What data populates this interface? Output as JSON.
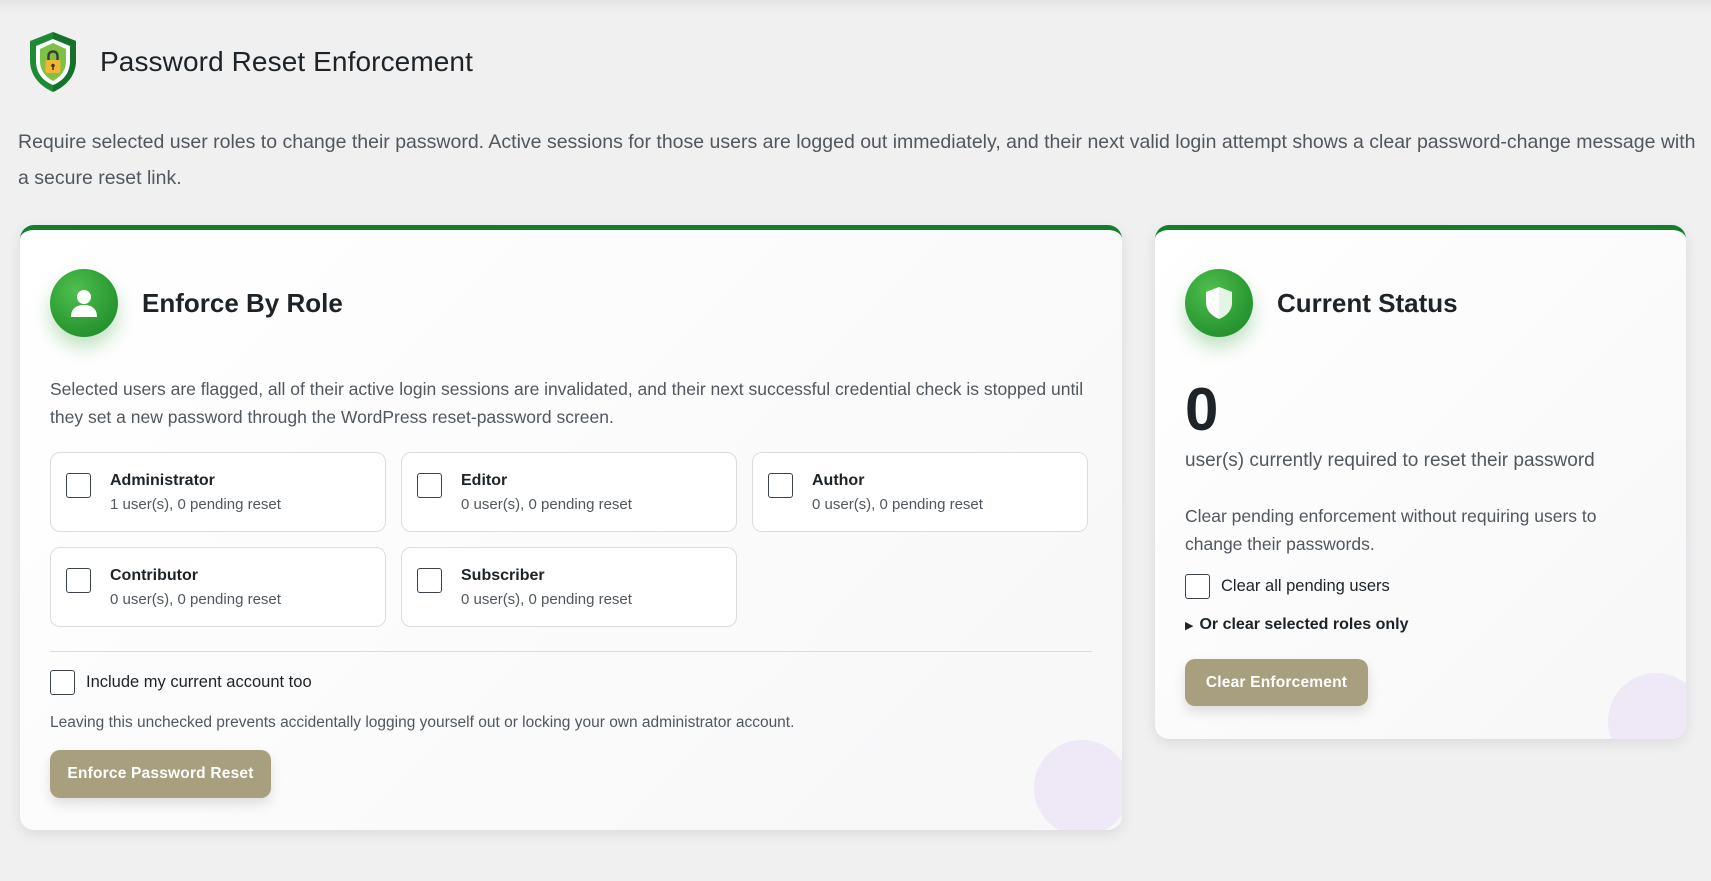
{
  "page": {
    "title": "Password Reset Enforcement",
    "intro": "Require selected user roles to change their password. Active sessions for those users are logged out immediately, and their next valid login attempt shows a clear password-change message with a secure reset link."
  },
  "enforce": {
    "title": "Enforce By Role",
    "description": "Selected users are flagged, all of their active login sessions are invalidated, and their next successful credential check is stopped until they set a new password through the WordPress reset-password screen.",
    "roles": [
      {
        "name": "Administrator",
        "meta": "1 user(s), 0 pending reset"
      },
      {
        "name": "Editor",
        "meta": "0 user(s), 0 pending reset"
      },
      {
        "name": "Author",
        "meta": "0 user(s), 0 pending reset"
      },
      {
        "name": "Contributor",
        "meta": "0 user(s), 0 pending reset"
      },
      {
        "name": "Subscriber",
        "meta": "0 user(s), 0 pending reset"
      }
    ],
    "include_label": "Include my current account too",
    "include_help": "Leaving this unchecked prevents accidentally logging yourself out or locking your own administrator account.",
    "button": "Enforce Password Reset"
  },
  "status": {
    "title": "Current Status",
    "count": "0",
    "count_label": "user(s) currently required to reset their password",
    "clear_description": "Clear pending enforcement without requiring users to change their passwords.",
    "clear_all_label": "Clear all pending users",
    "selected_roles_summary": "Or clear selected roles only",
    "button": "Clear Enforcement"
  },
  "colors": {
    "accent_green": "#137d2e",
    "badge_green": "#2e9e35",
    "button": "#a89f7f",
    "background": "#f0f0f1"
  },
  "icons": {
    "logo": "shield-lock-icon",
    "role_badge": "user-icon",
    "status_badge": "shield-icon",
    "summary_marker": "triangle-right-icon"
  }
}
